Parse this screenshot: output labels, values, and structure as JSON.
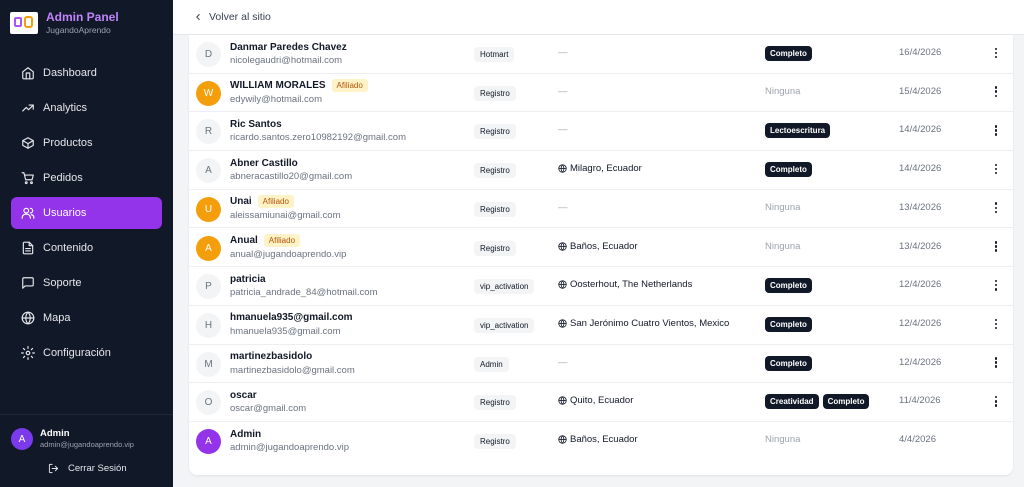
{
  "app": {
    "title": "Admin Panel",
    "subtitle": "JugandoAprendo"
  },
  "nav": [
    {
      "label": "Dashboard",
      "icon": "home-icon",
      "active": false
    },
    {
      "label": "Analytics",
      "icon": "trending-up-icon",
      "active": false
    },
    {
      "label": "Productos",
      "icon": "box-icon",
      "active": false
    },
    {
      "label": "Pedidos",
      "icon": "cart-icon",
      "active": false
    },
    {
      "label": "Usuarios",
      "icon": "users-icon",
      "active": true
    },
    {
      "label": "Contenido",
      "icon": "document-icon",
      "active": false
    },
    {
      "label": "Soporte",
      "icon": "chat-icon",
      "active": false
    },
    {
      "label": "Mapa",
      "icon": "globe-icon",
      "active": false
    },
    {
      "label": "Configuración",
      "icon": "gear-icon",
      "active": false
    }
  ],
  "user": {
    "initial": "A",
    "name": "Admin",
    "email": "admin@jugandoaprendo.vip"
  },
  "logout_label": "Cerrar Sesión",
  "back_label": "Volver al sitio",
  "colors": {
    "sidebar": "#111827",
    "accent": "#9333ea",
    "affiliate_bg": "#fef3c7",
    "affiliate_text": "#b45309"
  },
  "users": [
    {
      "initial": "D",
      "avatar": "gray",
      "name": "Danmar Paredes Chavez",
      "affiliate": "",
      "email": "nicolegaudri@hotmail.com",
      "source": "Hotmart",
      "location": "",
      "location_empty": "—",
      "courses": [
        "Completo"
      ],
      "courses_empty": "",
      "date": "16/4/2026"
    },
    {
      "initial": "W",
      "avatar": "orange",
      "name": "WILLIAM MORALES",
      "affiliate": "Afiliado",
      "email": "edywily@hotmail.com",
      "source": "Registro",
      "location": "",
      "location_empty": "—",
      "courses": [],
      "courses_empty": "Ninguna",
      "date": "15/4/2026"
    },
    {
      "initial": "R",
      "avatar": "gray",
      "name": "Ric Santos",
      "affiliate": "",
      "email": "ricardo.santos.zero10982192@gmail.com",
      "source": "Registro",
      "location": "",
      "location_empty": "—",
      "courses": [
        "Lectoescritura"
      ],
      "courses_empty": "",
      "date": "14/4/2026"
    },
    {
      "initial": "A",
      "avatar": "gray",
      "name": "Abner Castillo",
      "affiliate": "",
      "email": "abneracastillo20@gmail.com",
      "source": "Registro",
      "location": "Milagro, Ecuador",
      "location_empty": "",
      "courses": [
        "Completo"
      ],
      "courses_empty": "",
      "date": "14/4/2026"
    },
    {
      "initial": "U",
      "avatar": "orange",
      "name": "Unai",
      "affiliate": "Afiliado",
      "email": "aleissamiunai@gmail.com",
      "source": "Registro",
      "location": "",
      "location_empty": "—",
      "courses": [],
      "courses_empty": "Ninguna",
      "date": "13/4/2026"
    },
    {
      "initial": "A",
      "avatar": "orange",
      "name": "Anual",
      "affiliate": "Afiliado",
      "email": "anual@jugandoaprendo.vip",
      "source": "Registro",
      "location": "Baños, Ecuador",
      "location_empty": "",
      "courses": [],
      "courses_empty": "Ninguna",
      "date": "13/4/2026"
    },
    {
      "initial": "P",
      "avatar": "gray",
      "name": "patricia",
      "affiliate": "",
      "email": "patricia_andrade_84@hotmail.com",
      "source": "vip_activation",
      "location": "Oosterhout, The Netherlands",
      "location_empty": "",
      "courses": [
        "Completo"
      ],
      "courses_empty": "",
      "date": "12/4/2026"
    },
    {
      "initial": "H",
      "avatar": "gray",
      "name": "hmanuela935@gmail.com",
      "affiliate": "",
      "email": "hmanuela935@gmail.com",
      "source": "vip_activation",
      "location": "San Jerónimo Cuatro Vientos, Mexico",
      "location_empty": "",
      "courses": [
        "Completo"
      ],
      "courses_empty": "",
      "date": "12/4/2026"
    },
    {
      "initial": "M",
      "avatar": "gray",
      "name": "martinezbasidolo",
      "affiliate": "",
      "email": "martinezbasidolo@gmail.com",
      "source": "Admin",
      "location": "",
      "location_empty": "—",
      "courses": [
        "Completo"
      ],
      "courses_empty": "",
      "date": "12/4/2026"
    },
    {
      "initial": "O",
      "avatar": "gray",
      "name": "oscar",
      "affiliate": "",
      "email": "oscar@gmail.com",
      "source": "Registro",
      "location": "Quito, Ecuador",
      "location_empty": "",
      "courses": [
        "Creatividad",
        "Completo"
      ],
      "courses_empty": "",
      "date": "11/4/2026"
    },
    {
      "initial": "A",
      "avatar": "purple",
      "name": "Admin",
      "affiliate": "",
      "email": "admin@jugandoaprendo.vip",
      "source": "Registro",
      "location": "Baños, Ecuador",
      "location_empty": "",
      "courses": [],
      "courses_empty": "Ninguna",
      "date": "4/4/2026",
      "no_menu": true
    }
  ]
}
